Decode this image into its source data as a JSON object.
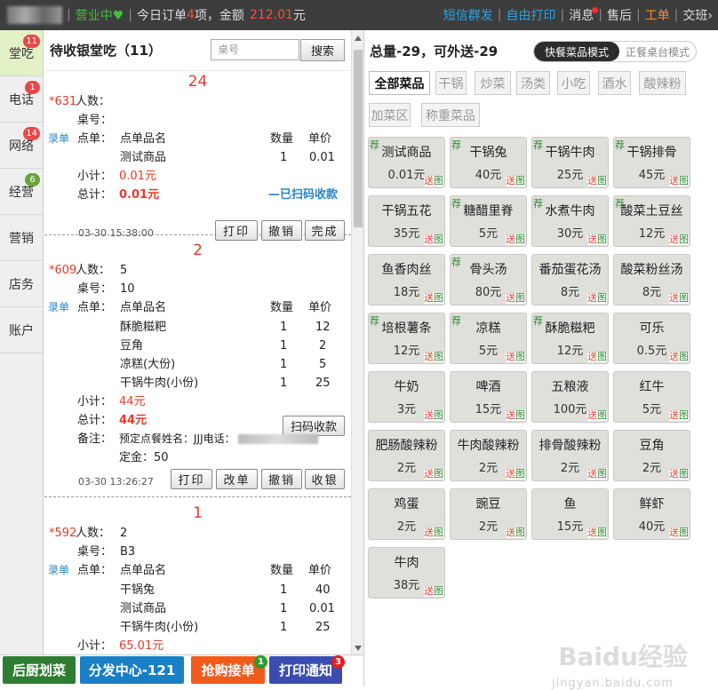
{
  "topbar": {
    "status": "营业中",
    "heart": "♥",
    "today_orders_prefix": "今日订单",
    "today_orders_count": "4",
    "today_orders_mid": "项，金额",
    "today_amount": "212.01",
    "today_amount_suffix": "元",
    "links": [
      "短信群发",
      "自由打印"
    ],
    "nav": [
      "消息",
      "售后",
      "工单",
      "交班"
    ],
    "more_arrow": "›"
  },
  "sidebar": {
    "items": [
      {
        "label": "堂吃",
        "badge": "11"
      },
      {
        "label": "电话",
        "badge": "1"
      },
      {
        "label": "网络",
        "badge": "14"
      },
      {
        "label": "经营",
        "badge": "6"
      },
      {
        "label": "营销",
        "badge": ""
      },
      {
        "label": "店务",
        "badge": ""
      },
      {
        "label": "账户",
        "badge": ""
      }
    ]
  },
  "orders": {
    "title": "待收银堂吃（11）",
    "search_placeholder": "桌号",
    "search_label": "搜索",
    "labels": {
      "people": "人数：",
      "table": "桌号：",
      "order_label": "点单：",
      "item_header": "点单品名",
      "qty_header": "数量",
      "price_header": "单价",
      "subtotal": "小计：",
      "total": "总计：",
      "enter": "录单",
      "note": "备注：",
      "deposit_prefix": "定金：",
      "star": "*"
    },
    "list": [
      {
        "number": "24",
        "id": "631",
        "people": "",
        "table": "",
        "items": [
          {
            "name": "测试商品",
            "qty": "1",
            "price": "0.01"
          }
        ],
        "subtotal": "0.01元",
        "total": "0.01元",
        "paid_label": "—已扫码收款",
        "time": "03-30 15:38:00",
        "buttons": [
          "打印",
          "撤销",
          "完成"
        ]
      },
      {
        "number": "2",
        "id": "609",
        "people": "5",
        "table": "10",
        "items": [
          {
            "name": "酥脆糍粑",
            "qty": "1",
            "price": "12"
          },
          {
            "name": "豆角",
            "qty": "1",
            "price": "2"
          },
          {
            "name": "凉糕(大份)",
            "qty": "1",
            "price": "5"
          },
          {
            "name": "干锅牛肉(小份)",
            "qty": "1",
            "price": "25"
          }
        ],
        "subtotal": "44元",
        "total": "44元",
        "scan_label": "扫码收款",
        "note": "预定点餐姓名：JJJ电话：",
        "deposit": "50",
        "time": "03-30 13:26:27",
        "buttons": [
          "打印",
          "改单",
          "撤销",
          "收银"
        ]
      },
      {
        "number": "1",
        "id": "592",
        "people": "2",
        "table": "B3",
        "items": [
          {
            "name": "干锅兔",
            "qty": "1",
            "price": "40"
          },
          {
            "name": "测试商品",
            "qty": "1",
            "price": "0.01"
          },
          {
            "name": "干锅牛肉(小份)",
            "qty": "1",
            "price": "25"
          }
        ],
        "subtotal": "65.01元"
      }
    ]
  },
  "menu": {
    "total": "总量-29，可外送-29",
    "mode_fast": "快餐菜品模式",
    "mode_table": "正餐桌台模式",
    "categories": [
      "全部菜品",
      "干锅",
      "炒菜",
      "汤类",
      "小吃",
      "酒水",
      "酸辣粉",
      "加菜区",
      "称重菜品"
    ],
    "rec_mark": "荐",
    "send_mark": "送",
    "img_mark": "图",
    "dishes": [
      {
        "name": "测试商品",
        "price": "0.01元",
        "rec": true
      },
      {
        "name": "干锅兔",
        "price": "40元",
        "rec": true
      },
      {
        "name": "干锅牛肉",
        "price": "25元",
        "rec": true
      },
      {
        "name": "干锅排骨",
        "price": "45元",
        "rec": true
      },
      {
        "name": "干锅五花",
        "price": "35元",
        "rec": false
      },
      {
        "name": "糖醋里脊",
        "price": "5元",
        "rec": true
      },
      {
        "name": "水煮牛肉",
        "price": "30元",
        "rec": true
      },
      {
        "name": "酸菜土豆丝",
        "price": "12元",
        "rec": true
      },
      {
        "name": "鱼香肉丝",
        "price": "18元",
        "rec": false
      },
      {
        "name": "骨头汤",
        "price": "80元",
        "rec": true
      },
      {
        "name": "番茄蛋花汤",
        "price": "8元",
        "rec": false
      },
      {
        "name": "酸菜粉丝汤",
        "price": "8元",
        "rec": false
      },
      {
        "name": "培根薯条",
        "price": "12元",
        "rec": true
      },
      {
        "name": "凉糕",
        "price": "5元",
        "rec": true
      },
      {
        "name": "酥脆糍粑",
        "price": "12元",
        "rec": true
      },
      {
        "name": "可乐",
        "price": "0.5元",
        "rec": false
      },
      {
        "name": "牛奶",
        "price": "3元",
        "rec": false
      },
      {
        "name": "啤酒",
        "price": "15元",
        "rec": false
      },
      {
        "name": "五粮液",
        "price": "100元",
        "rec": false
      },
      {
        "name": "红牛",
        "price": "5元",
        "rec": false
      },
      {
        "name": "肥肠酸辣粉",
        "price": "2元",
        "rec": false
      },
      {
        "name": "牛肉酸辣粉",
        "price": "2元",
        "rec": false
      },
      {
        "name": "排骨酸辣粉",
        "price": "2元",
        "rec": false
      },
      {
        "name": "豆角",
        "price": "2元",
        "rec": false
      },
      {
        "name": "鸡蛋",
        "price": "2元",
        "rec": false
      },
      {
        "name": "豌豆",
        "price": "2元",
        "rec": false
      },
      {
        "name": "鱼",
        "price": "15元",
        "rec": false
      },
      {
        "name": "鲜虾",
        "price": "40元",
        "rec": false
      },
      {
        "name": "牛肉",
        "price": "38元",
        "rec": false
      }
    ]
  },
  "bottom": {
    "buttons": [
      {
        "label": "后厨划菜",
        "badge": "",
        "color": "#2e7d32"
      },
      {
        "label": "分发中心-121",
        "badge": "",
        "color": "#1a7fc4"
      },
      {
        "label": "抢购接单",
        "badge": "1",
        "color": "#f05a1a"
      },
      {
        "label": "打印通知",
        "badge": "3",
        "color": "#3b4cb0"
      }
    ]
  },
  "watermark": {
    "text": "Baidu经验",
    "url": "jingyan.baidu.com"
  }
}
